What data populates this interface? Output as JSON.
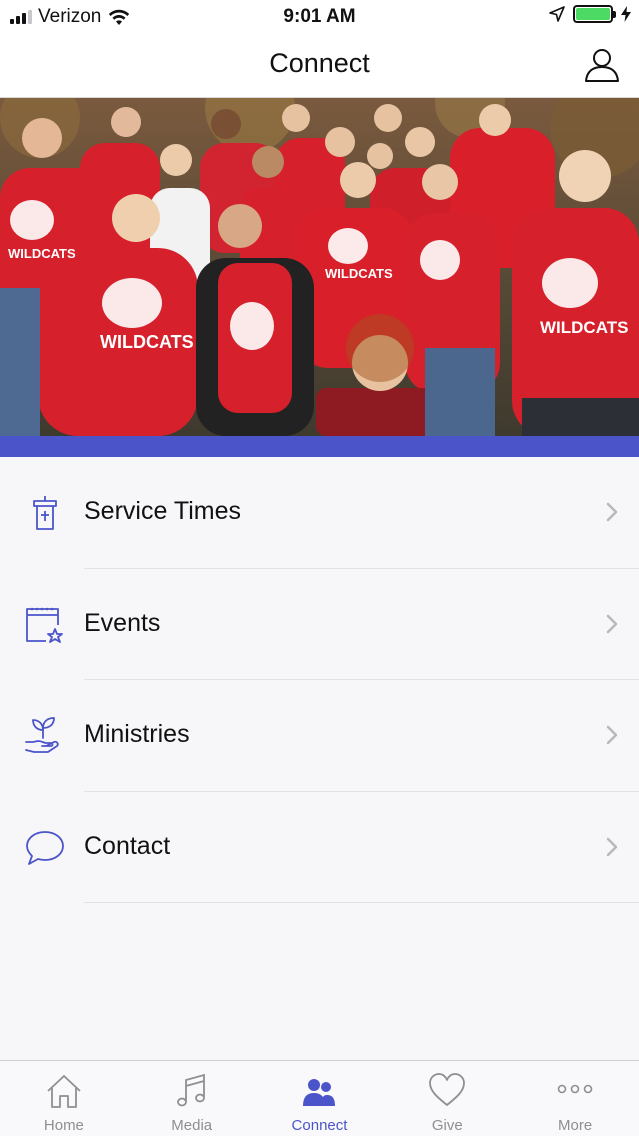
{
  "status_bar": {
    "carrier": "Verizon",
    "time": "9:01 AM",
    "battery_level": 1.0
  },
  "header": {
    "title": "Connect"
  },
  "hero": {
    "banner_text": "WILDCATS"
  },
  "menu": [
    {
      "label": "Service Times",
      "icon": "pulpit-icon"
    },
    {
      "label": "Events",
      "icon": "calendar-star-icon"
    },
    {
      "label": "Ministries",
      "icon": "hand-plant-icon"
    },
    {
      "label": "Contact",
      "icon": "speech-bubble-icon"
    }
  ],
  "tabs": [
    {
      "label": "Home",
      "icon": "home-icon",
      "active": false
    },
    {
      "label": "Media",
      "icon": "music-note-icon",
      "active": false
    },
    {
      "label": "Connect",
      "icon": "people-icon",
      "active": true
    },
    {
      "label": "Give",
      "icon": "heart-icon",
      "active": false
    },
    {
      "label": "More",
      "icon": "more-dots-icon",
      "active": false
    }
  ],
  "colors": {
    "accent": "#4b55c9",
    "inactive": "#8e8e93",
    "shirt_red": "#d6202b",
    "battery_green": "#4cd964"
  }
}
